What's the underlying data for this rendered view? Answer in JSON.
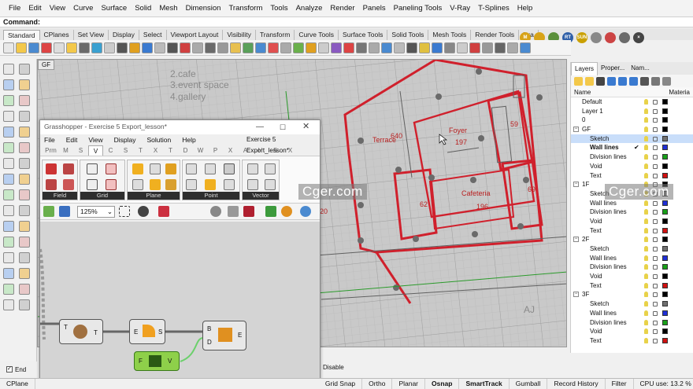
{
  "menu": [
    "File",
    "Edit",
    "View",
    "Curve",
    "Surface",
    "Solid",
    "Mesh",
    "Dimension",
    "Transform",
    "Tools",
    "Analyze",
    "Render",
    "Panels",
    "Paneling Tools",
    "V-Ray",
    "T-Splines",
    "Help"
  ],
  "command_label": "Command:",
  "toolbar_tabs": [
    "Standard",
    "CPlanes",
    "Set View",
    "Display",
    "Select",
    "Viewport Layout",
    "Visibility",
    "Transform",
    "Curve Tools",
    "Surface Tools",
    "Solid Tools",
    "Mesh Tools",
    "Render Tools",
    "Dra"
  ],
  "toolbar_icon_labels": [
    "M",
    "RT",
    "SUN"
  ],
  "viewport": {
    "label": "GF",
    "legend": [
      "2.cafe",
      "3.event space",
      "4.gallery"
    ],
    "rooms": [
      "Foyer",
      "197",
      "Terrace",
      "640",
      "59",
      "62",
      "Cafeteria",
      "196",
      "69",
      "20"
    ],
    "corner_text": "AJ"
  },
  "grasshopper": {
    "title": "Grasshopper - Exercise 5 Export_lesson*",
    "doc_title": "Exercise 5 Export_lesson*",
    "menu": [
      "File",
      "Edit",
      "View",
      "Display",
      "Solution",
      "Help"
    ],
    "tabs": [
      "Prm",
      "M",
      "S",
      "V",
      "C",
      "S",
      "T",
      "X",
      "T",
      "D",
      "W",
      "P",
      "X",
      "A",
      "H",
      "S",
      "X"
    ],
    "active_tab": "V",
    "groups": [
      "Field",
      "Grid",
      "Plane",
      "Point",
      "Vector"
    ],
    "zoom": "125%",
    "nodes": {
      "n1": {
        "in": "T",
        "out": "T"
      },
      "n2": {
        "in": "E",
        "out": "S"
      },
      "n3": {
        "in1": "B",
        "in2": "D",
        "out": "E"
      },
      "n4": {
        "in": "F",
        "out": "V"
      }
    }
  },
  "layers_panel": {
    "tabs": [
      "Layers",
      "Proper...",
      "Nam..."
    ],
    "col_name": "Name",
    "col_material": "Materia",
    "rows": [
      {
        "name": "Default",
        "indent": 1,
        "color": "#000000"
      },
      {
        "name": "Layer 1",
        "indent": 1,
        "color": "#000000"
      },
      {
        "name": "0",
        "indent": 1,
        "color": "#000000"
      },
      {
        "name": "GF",
        "indent": 0,
        "color": "#000000",
        "group": true
      },
      {
        "name": "Sketch",
        "indent": 2,
        "color": "#707070",
        "selected": true
      },
      {
        "name": "Wall lines",
        "indent": 2,
        "color": "#1f2fd6",
        "bold": true,
        "current": true
      },
      {
        "name": "Division lines",
        "indent": 2,
        "color": "#18a018"
      },
      {
        "name": "Void",
        "indent": 2,
        "color": "#000000"
      },
      {
        "name": "Text",
        "indent": 2,
        "color": "#d01010"
      },
      {
        "name": "1F",
        "indent": 0,
        "color": "#000000",
        "group": true
      },
      {
        "name": "Sketch",
        "indent": 2,
        "color": "#707070"
      },
      {
        "name": "Wall lines",
        "indent": 2,
        "color": "#1f2fd6"
      },
      {
        "name": "Division lines",
        "indent": 2,
        "color": "#18a018"
      },
      {
        "name": "Void",
        "indent": 2,
        "color": "#000000"
      },
      {
        "name": "Text",
        "indent": 2,
        "color": "#d01010"
      },
      {
        "name": "2F",
        "indent": 0,
        "color": "#000000",
        "group": true
      },
      {
        "name": "Sketch",
        "indent": 2,
        "color": "#707070"
      },
      {
        "name": "Wall lines",
        "indent": 2,
        "color": "#1f2fd6"
      },
      {
        "name": "Division lines",
        "indent": 2,
        "color": "#18a018"
      },
      {
        "name": "Void",
        "indent": 2,
        "color": "#000000"
      },
      {
        "name": "Text",
        "indent": 2,
        "color": "#d01010"
      },
      {
        "name": "3F",
        "indent": 0,
        "color": "#000000",
        "group": true
      },
      {
        "name": "Sketch",
        "indent": 2,
        "color": "#707070"
      },
      {
        "name": "Wall lines",
        "indent": 2,
        "color": "#1f2fd6"
      },
      {
        "name": "Division lines",
        "indent": 2,
        "color": "#18a018"
      },
      {
        "name": "Void",
        "indent": 2,
        "color": "#000000"
      },
      {
        "name": "Text",
        "indent": 2,
        "color": "#d01010"
      }
    ]
  },
  "osnap_left": {
    "end_label": "End"
  },
  "disable_label": "Disable",
  "statusbar": [
    "CPlane",
    "Grid Snap",
    "Ortho",
    "Planar",
    "Osnap",
    "SmartTrack",
    "Gumball",
    "Record History",
    "Filter",
    "CPU use: 13.2 %"
  ],
  "watermark": "Cger.com",
  "colors": {
    "wall_red": "#d0202c",
    "accent_select": "#c9defa"
  }
}
